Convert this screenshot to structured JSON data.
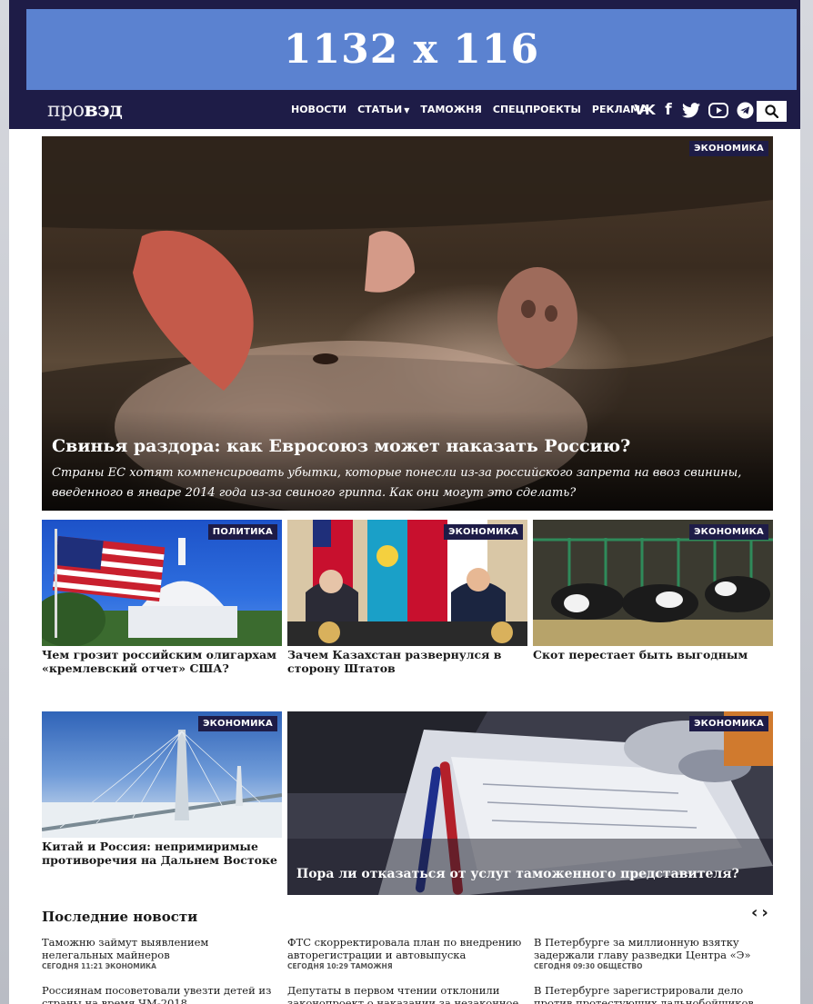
{
  "ad": {
    "text": "1132 x 116"
  },
  "logo": {
    "light": "про",
    "bold": "вэд"
  },
  "menu": [
    {
      "label": "НОВОСТИ"
    },
    {
      "label": "СТАТЬИ"
    },
    {
      "label": "ТАМОЖНЯ"
    },
    {
      "label": "СПЕЦПРОЕКТЫ"
    },
    {
      "label": "РЕКЛАМА"
    }
  ],
  "social": {
    "vk": "VK",
    "fb": "f"
  },
  "hero": {
    "tag": "ЭКОНОМИКА",
    "title": "Свинья раздора: как Евросоюз может наказать Россию?",
    "lead": "Страны ЕС хотят компенсировать убытки, которые понесли из-за российского запрета на ввоз свинины, введенного в январе 2014 года из-за свиного гриппа. Как они могут это сделать?"
  },
  "cards": [
    {
      "tag": "ПОЛИТИКА",
      "title": "Чем грозит российским олигархам «кремлевский отчет» США?"
    },
    {
      "tag": "ЭКОНОМИКА",
      "title": "Зачем Казахстан развернулся в сторону Штатов"
    },
    {
      "tag": "ЭКОНОМИКА",
      "title": "Скот перестает быть выгодным"
    },
    {
      "tag": "ЭКОНОМИКА",
      "title": "Китай и Россия: непримиримые противоречия на Дальнем Востоке"
    },
    {
      "tag": "ЭКОНОМИКА",
      "title": "Пора ли отказаться от услуг таможенного представителя?"
    }
  ],
  "latest": {
    "heading": "Последние новости",
    "prev": "‹",
    "next": "›",
    "items": [
      {
        "title": "Таможню займут выявлением нелегальных майнеров",
        "meta": "СЕГОДНЯ 11:21  ЭКОНОМИКА"
      },
      {
        "title": "ФТС скорректировала план по внедрению авторегистрации и автовыпуска",
        "meta": "СЕГОДНЯ 10:29  ТАМОЖНЯ"
      },
      {
        "title": "В Петербурге за миллионную взятку задержали главу разведки Центра «Э»",
        "meta": "СЕГОДНЯ 09:30  ОБЩЕСТВО"
      },
      {
        "title": "Россиянам посоветовали увезти детей из страны на время ЧМ-2018",
        "meta": ""
      },
      {
        "title": "Депутаты в первом чтении отклонили законопроект о наказании за незаконное",
        "meta": ""
      },
      {
        "title": "В Петербурге зарегистрировали дело против протестующих дальнобойщиков",
        "meta": ""
      }
    ]
  }
}
